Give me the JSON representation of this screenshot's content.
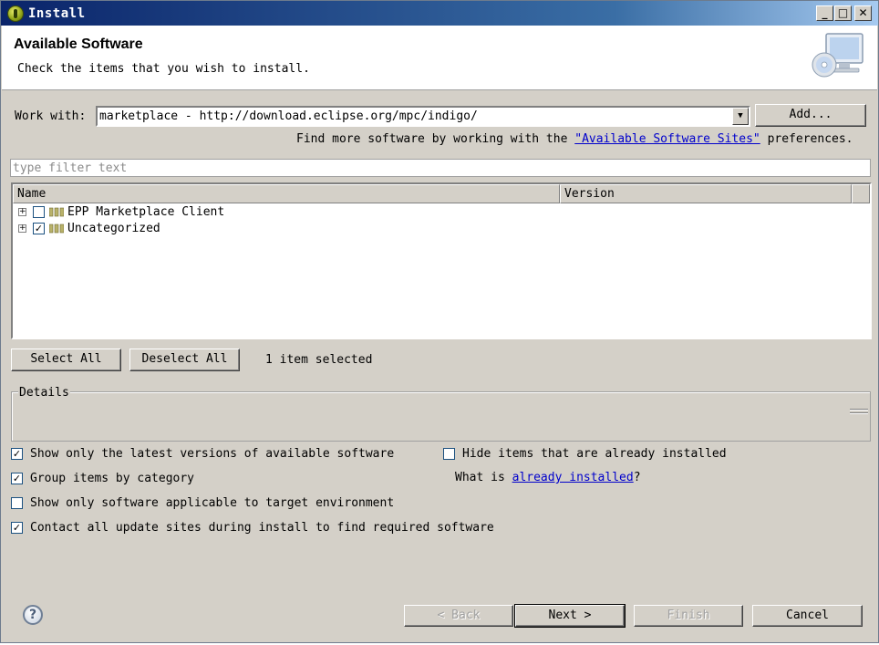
{
  "window": {
    "title": "Install",
    "controls": {
      "minimize": "_",
      "maximize": "□",
      "close": "✕"
    }
  },
  "header": {
    "title": "Available Software",
    "description": "Check the items that you wish to install."
  },
  "work_with": {
    "label": "Work with:",
    "value": "marketplace - http://download.eclipse.org/mpc/indigo/",
    "add_button": "Add...",
    "more_prefix": "Find more software by working with the ",
    "more_link": "\"Available Software Sites\"",
    "more_suffix": " preferences."
  },
  "filter": {
    "placeholder": "type filter text"
  },
  "tree": {
    "columns": [
      "Name",
      "Version"
    ],
    "items": [
      {
        "label": "EPP Marketplace Client",
        "checked": false,
        "expander": "+"
      },
      {
        "label": "Uncategorized",
        "checked": true,
        "expander": "+"
      }
    ]
  },
  "selection": {
    "select_all": "Select All",
    "deselect_all": "Deselect All",
    "status": "1 item selected"
  },
  "details": {
    "label": "Details"
  },
  "options": {
    "latest_versions": {
      "label": "Show only the latest versions of available software",
      "checked": true
    },
    "group_by_category": {
      "label": "Group items by category",
      "checked": true
    },
    "applicable_only": {
      "label": "Show only software applicable to target environment",
      "checked": false
    },
    "contact_sites": {
      "label": "Contact all update sites during install to find required software",
      "checked": true
    },
    "hide_installed": {
      "label": "Hide items that are already installed",
      "checked": false
    },
    "what_is_prefix": "What is ",
    "what_is_link": "already installed",
    "what_is_suffix": "?"
  },
  "footer": {
    "help_icon": "?",
    "back": "< Back",
    "next": "Next >",
    "finish": "Finish",
    "cancel": "Cancel"
  },
  "colors": {
    "dialog_bg": "#d4d0c8",
    "title_bar": "#0a246a",
    "link": "#0000cc"
  }
}
